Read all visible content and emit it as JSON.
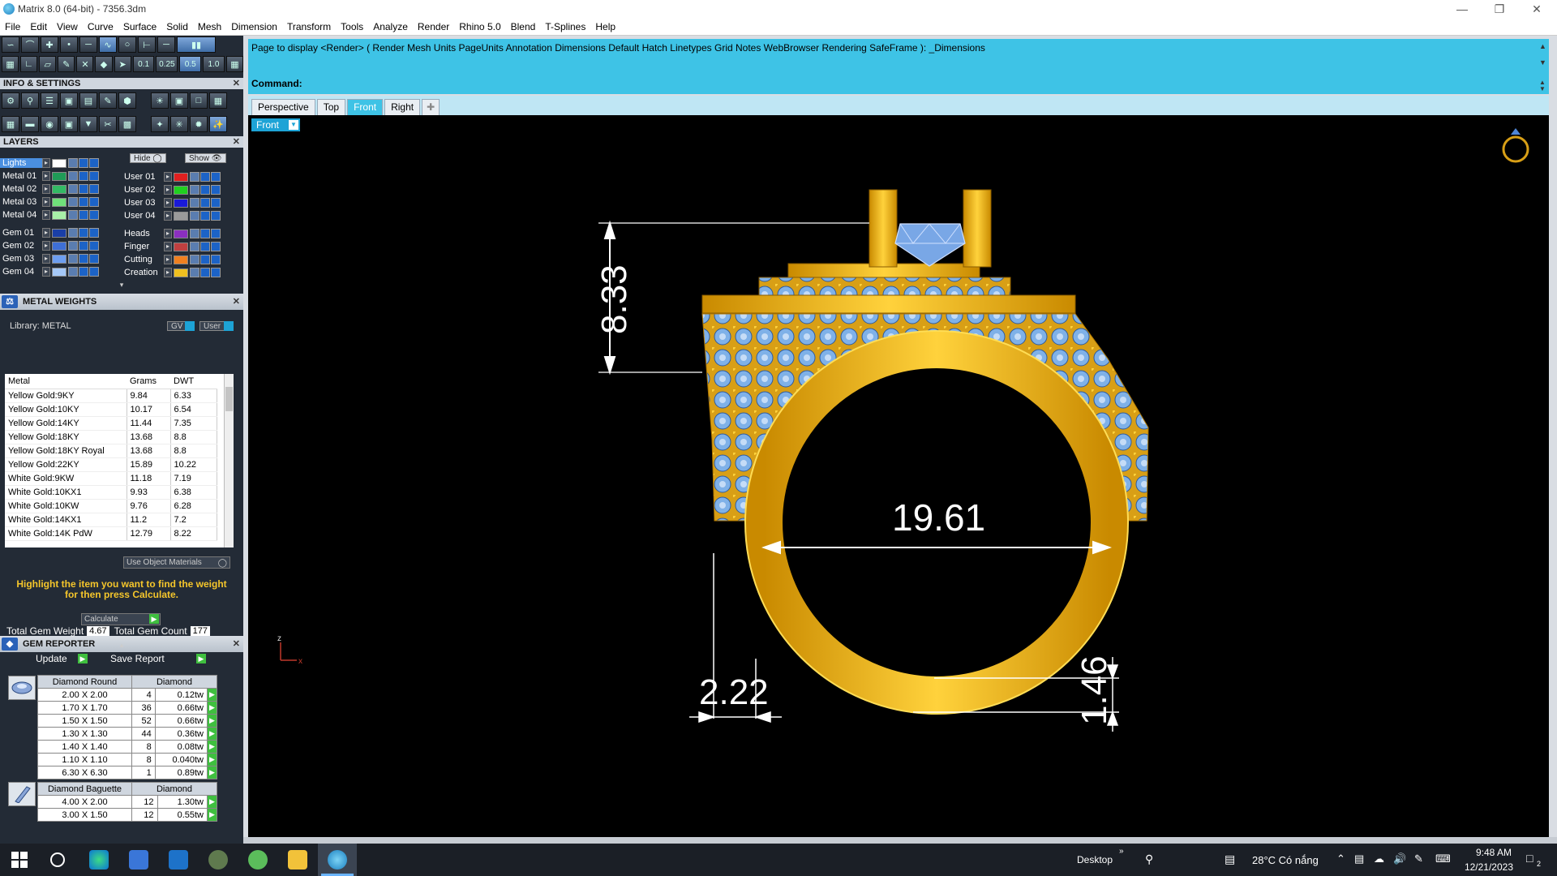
{
  "window": {
    "title": "Matrix 8.0 (64-bit) - 7356.3dm",
    "minimize_icon": "minimize-icon",
    "maximize_icon": "restore-icon",
    "close_icon": "close-icon"
  },
  "menu": [
    "File",
    "Edit",
    "View",
    "Curve",
    "Surface",
    "Solid",
    "Mesh",
    "Dimension",
    "Transform",
    "Tools",
    "Analyze",
    "Render",
    "Rhino 5.0",
    "Blend",
    "T-Splines",
    "Help"
  ],
  "toolbar": {
    "snap_values": [
      "0.1",
      "0.25",
      "0.5",
      "1.0"
    ]
  },
  "info_settings": {
    "title": "INFO & SETTINGS"
  },
  "layers": {
    "title": "LAYERS",
    "hide_label": "Hide",
    "show_label": "Show",
    "left": [
      {
        "name": "Lights",
        "color": "#ffffff"
      },
      {
        "name": "Metal 01",
        "color": "#1f9b57"
      },
      {
        "name": "Metal 02",
        "color": "#33b964"
      },
      {
        "name": "Metal 03",
        "color": "#6fe07a"
      },
      {
        "name": "Metal 04",
        "color": "#a8f0a8"
      },
      {
        "name": "Gem 01",
        "color": "#1a3fa8"
      },
      {
        "name": "Gem 02",
        "color": "#3e6fd6"
      },
      {
        "name": "Gem 03",
        "color": "#6d9ef0"
      },
      {
        "name": "Gem 04",
        "color": "#a5c8f7"
      }
    ],
    "right": [
      {
        "name": "User 01",
        "color": "#e02020"
      },
      {
        "name": "User 02",
        "color": "#20d020"
      },
      {
        "name": "User 03",
        "color": "#1a1ad8"
      },
      {
        "name": "User 04",
        "color": "#9a9a9a"
      },
      {
        "name": "Heads",
        "color": "#8b2fc0"
      },
      {
        "name": "Finger",
        "color": "#c04040"
      },
      {
        "name": "Cutting",
        "color": "#f08020"
      },
      {
        "name": "Creation",
        "color": "#f0c020"
      }
    ]
  },
  "metal_weights": {
    "title": "METAL WEIGHTS",
    "library_label": "Library: METAL",
    "gv_label": "GV",
    "user_label": "User",
    "columns": [
      "Metal",
      "Grams",
      "DWT"
    ],
    "rows": [
      [
        "Yellow Gold:9KY",
        "9.84",
        "6.33"
      ],
      [
        "Yellow Gold:10KY",
        "10.17",
        "6.54"
      ],
      [
        "Yellow Gold:14KY",
        "11.44",
        "7.35"
      ],
      [
        "Yellow Gold:18KY",
        "13.68",
        "8.8"
      ],
      [
        "Yellow Gold:18KY Royal",
        "13.68",
        "8.8"
      ],
      [
        "Yellow Gold:22KY",
        "15.89",
        "10.22"
      ],
      [
        "White Gold:9KW",
        "11.18",
        "7.19"
      ],
      [
        "White Gold:10KX1",
        "9.93",
        "6.38"
      ],
      [
        "White Gold:10KW",
        "9.76",
        "6.28"
      ],
      [
        "White Gold:14KX1",
        "11.2",
        "7.2"
      ],
      [
        "White Gold:14K PdW",
        "12.79",
        "8.22"
      ]
    ],
    "use_object_materials": "Use Object Materials",
    "hint": "Highlight the item you want to find the weight for then press Calculate.",
    "calculate_label": "Calculate"
  },
  "gem_reporter": {
    "title": "GEM REPORTER",
    "total_weight_label": "Total Gem Weight",
    "total_weight": "4.67",
    "total_count_label": "Total Gem Count",
    "total_count": "177",
    "update_label": "Update",
    "save_label": "Save Report",
    "groups": [
      {
        "shape": "Diamond Round",
        "material": "Diamond",
        "icon": "round-gem-icon",
        "rows": [
          [
            "2.00 X 2.00",
            "4",
            "0.12tw"
          ],
          [
            "1.70 X 1.70",
            "36",
            "0.66tw"
          ],
          [
            "1.50 X 1.50",
            "52",
            "0.66tw"
          ],
          [
            "1.30 X 1.30",
            "44",
            "0.36tw"
          ],
          [
            "1.40 X 1.40",
            "8",
            "0.08tw"
          ],
          [
            "1.10 X 1.10",
            "8",
            "0.040tw"
          ],
          [
            "6.30 X 6.30",
            "1",
            "0.89tw"
          ]
        ]
      },
      {
        "shape": "Diamond Baguette",
        "material": "Diamond",
        "icon": "baguette-gem-icon",
        "rows": [
          [
            "4.00 X 2.00",
            "12",
            "1.30tw"
          ],
          [
            "3.00 X 1.50",
            "12",
            "0.55tw"
          ]
        ]
      }
    ]
  },
  "command": {
    "history": "Page to display <Render> ( Render  Mesh  Units  PageUnits  Annotation  Dimensions  Default  Hatch  Linetypes  Grid  Notes  WebBrowser  Rendering  SafeFrame ): _Dimensions",
    "prompt": "Command:"
  },
  "viewport_tabs": [
    "Perspective",
    "Top",
    "Front",
    "Right"
  ],
  "active_viewport": "Front",
  "viewport_label": "Front",
  "dimensions": {
    "height": "8.33",
    "inner_diameter": "19.61",
    "shank_width": "2.22",
    "shank_thickness": "1.46"
  },
  "axis": {
    "z": "z",
    "x": "x"
  },
  "taskbar": {
    "desktop_label": "Desktop",
    "weather": "28°C  Có nắng",
    "time": "9:48 AM",
    "date": "12/21/2023",
    "notification_count": "2"
  }
}
